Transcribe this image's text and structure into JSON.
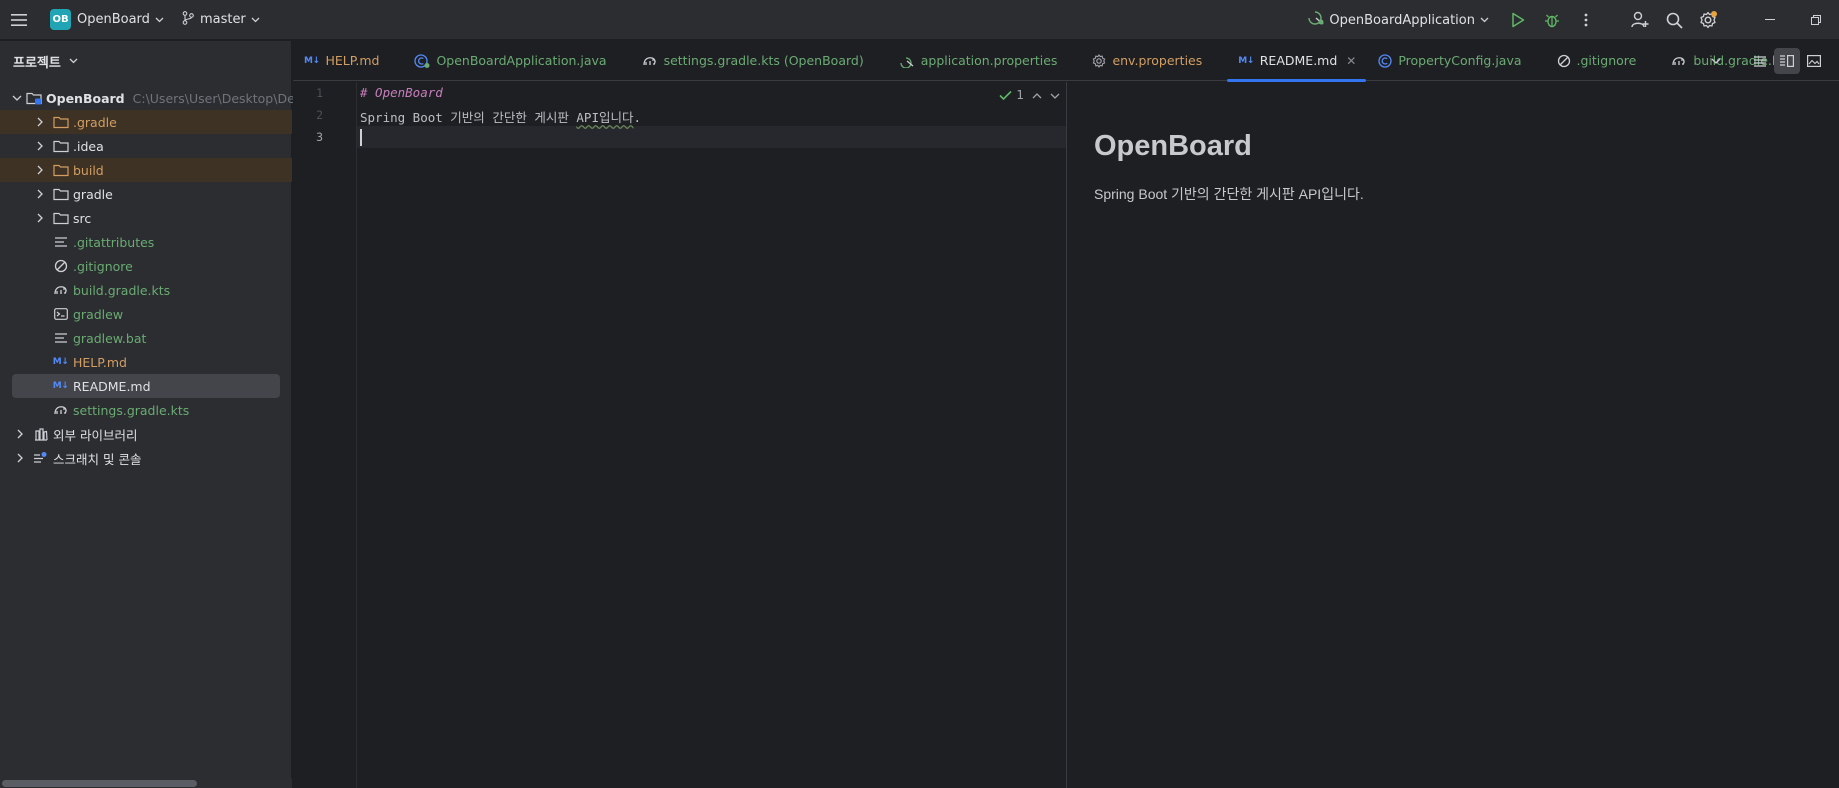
{
  "titlebar": {
    "project_badge": "OB",
    "project_name": "OpenBoard",
    "branch": "master",
    "run_config": "OpenBoardApplication"
  },
  "project_pane": {
    "title": "프로젝트",
    "root": {
      "name": "OpenBoard",
      "path": "C:\\Users\\User\\Desktop\\Devl"
    },
    "items": [
      {
        "label": ".gradle",
        "type": "folder",
        "color": "#d39e63"
      },
      {
        "label": ".idea",
        "type": "folder",
        "color": "#dfe1e5"
      },
      {
        "label": "build",
        "type": "folder",
        "color": "#d39e63"
      },
      {
        "label": "gradle",
        "type": "folder",
        "color": "#dfe1e5"
      },
      {
        "label": "src",
        "type": "folder",
        "color": "#dfe1e5"
      },
      {
        "label": ".gitattributes",
        "type": "text-file",
        "color": "#6aab73"
      },
      {
        "label": ".gitignore",
        "type": "ignore-file",
        "color": "#6aab73"
      },
      {
        "label": "build.gradle.kts",
        "type": "gradle-file",
        "color": "#6aab73"
      },
      {
        "label": "gradlew",
        "type": "script-file",
        "color": "#6aab73"
      },
      {
        "label": "gradlew.bat",
        "type": "text-file",
        "color": "#6aab73"
      },
      {
        "label": "HELP.md",
        "type": "md-file",
        "color": "#d39e63"
      },
      {
        "label": "README.md",
        "type": "md-file",
        "color": "#dfe1e5"
      },
      {
        "label": "settings.gradle.kts",
        "type": "gradle-file",
        "color": "#6aab73"
      }
    ],
    "external_libraries": "외부 라이브러리",
    "scratches": "스크래치 및 콘솔"
  },
  "tabs": [
    {
      "label": "HELP.md",
      "icon": "md-icon",
      "color": "#d39e63"
    },
    {
      "label": "OpenBoardApplication.java",
      "icon": "spring-class-icon",
      "color": "#6aab73"
    },
    {
      "label": "settings.gradle.kts (OpenBoard)",
      "icon": "gradle-icon",
      "color": "#6aab73"
    },
    {
      "label": "application.properties",
      "icon": "spring-config-icon",
      "color": "#6aab73"
    },
    {
      "label": "env.properties",
      "icon": "gear-file-icon",
      "color": "#d39e63"
    },
    {
      "label": "README.md",
      "icon": "md-icon",
      "color": "#dfe1e5",
      "active": true
    },
    {
      "label": "PropertyConfig.java",
      "icon": "class-icon",
      "color": "#6aab73"
    },
    {
      "label": ".gitignore",
      "icon": "ignore-icon",
      "color": "#6aab73"
    },
    {
      "label": "build.gradle.kts",
      "icon": "gradle-icon",
      "color": "#6aab73"
    }
  ],
  "editor": {
    "line_numbers": [
      "1",
      "2",
      "3"
    ],
    "lines": [
      "# OpenBoard",
      "Spring Boot 기반의 간단한 게시판 API입니다.",
      ""
    ],
    "line2_prefix": "Spring Boot 기반의 간단한 게시판 ",
    "line2_squiggle": "API입니다",
    "line2_suffix": ".",
    "inspection_count": "1"
  },
  "preview": {
    "heading": "OpenBoard",
    "paragraph": "Spring Boot 기반의 간단한 게시판 API입니다."
  },
  "colors": {
    "accent": "#3574f0",
    "badge": "#21a5b4",
    "modified_green": "#6aab73",
    "ignored_orange": "#d39e63"
  }
}
